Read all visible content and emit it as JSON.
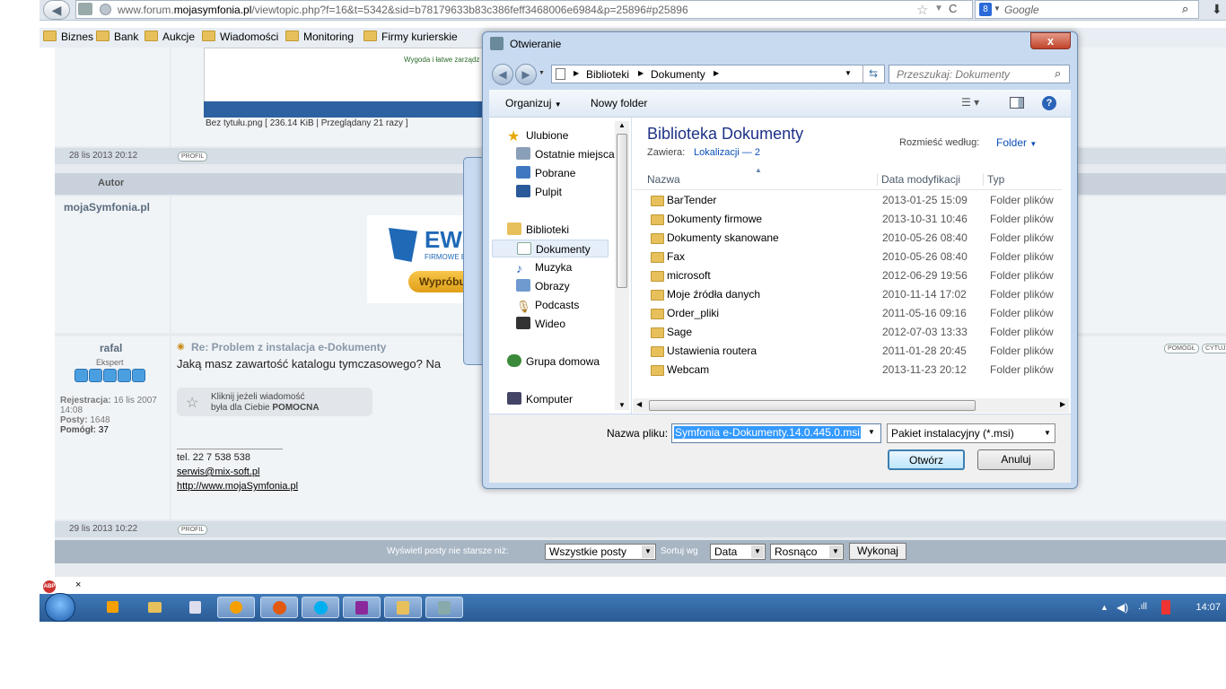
{
  "browser": {
    "url_prefix": "www.forum.",
    "url_domain": "mojasymfonia.pl",
    "url_suffix": "/viewtopic.php?f=16&t=5342&sid=b78179633b83c386feff3468006e6984&p=25896#p25896",
    "search_placeholder": "Google",
    "bookmarks": [
      "Biznes",
      "Bank",
      "Aukcje",
      "Wiadomości",
      "Monitoring",
      "Firmy kurierskie"
    ]
  },
  "forum": {
    "attachment_caption": "Bez tytułu.png [ 236.14 KiB | Przeglądany 21 razy ]",
    "banner_text": "Wygoda i łatwe zarządz",
    "post1_date": "28 lis 2013 20:12",
    "profil_label": "PROFIL",
    "author_header": "Autor",
    "ad_author": "mojaSymfonia.pl",
    "ad_logo": "EWI",
    "ad_sub": "FIRMOWE E",
    "ad_button": "Wypróbu",
    "user_name": "rafal",
    "user_rank": "Ekspert",
    "reg_label": "Rejestracja:",
    "reg_value": "16 lis 2007 14:08",
    "posts_label": "Posty:",
    "posts_value": "1648",
    "helped_label": "Pomógł:",
    "helped_value": "37",
    "post_title": "Re: Problem z instalacja e-Dokumenty",
    "post_text": "Jaką masz zawartość katalogu tymczasowego? Na",
    "helpful_line1": "Kliknij jeżeli wiadomość",
    "helpful_line2": "była dla Ciebie",
    "helpful_bold": "POMOCNA",
    "sig_phone": "tel. 22 7 538 538",
    "sig_email": "serwis@mix-soft.pl",
    "sig_url": "http://www.mojaSymfonia.pl",
    "post2_date": "29 lis 2013 10:22",
    "pomoge_label": "POMÓGŁ",
    "cytuj_label": "CYTUJ",
    "filter_label": "Wyświetl posty nie starsze niż:",
    "filter_value": "Wszystkie posty",
    "sort_label": "Sortuj wg",
    "sort_value": "Data",
    "order_value": "Rosnąco",
    "go_button": "Wykonaj"
  },
  "taskbar": {
    "clock": "14:07"
  },
  "dialog": {
    "title": "Otwieranie",
    "close": "x",
    "path": [
      "Biblioteki",
      "Dokumenty"
    ],
    "search_placeholder": "Przeszukaj: Dokumenty",
    "organize": "Organizuj",
    "new_folder": "Nowy folder",
    "library_title": "Biblioteka Dokumenty",
    "contains_label": "Zawiera:",
    "contains_link": "Lokalizacji — 2",
    "arrange_label": "Rozmieść według:",
    "arrange_value": "Folder",
    "col_name": "Nazwa",
    "col_date": "Data modyfikacji",
    "col_type": "Typ",
    "nav": {
      "favorites": "Ulubione",
      "recent": "Ostatnie miejsca",
      "downloads": "Pobrane",
      "desktop": "Pulpit",
      "libraries": "Biblioteki",
      "documents": "Dokumenty",
      "music": "Muzyka",
      "pictures": "Obrazy",
      "podcasts": "Podcasts",
      "video": "Wideo",
      "homegroup": "Grupa domowa",
      "computer": "Komputer"
    },
    "files": [
      {
        "name": "BarTender",
        "date": "2013-01-25 15:09",
        "type": "Folder plików"
      },
      {
        "name": "Dokumenty firmowe",
        "date": "2013-10-31 10:46",
        "type": "Folder plików"
      },
      {
        "name": "Dokumenty skanowane",
        "date": "2010-05-26 08:40",
        "type": "Folder plików"
      },
      {
        "name": "Fax",
        "date": "2010-05-26 08:40",
        "type": "Folder plików"
      },
      {
        "name": "microsoft",
        "date": "2012-06-29 19:56",
        "type": "Folder plików"
      },
      {
        "name": "Moje źródła danych",
        "date": "2010-11-14 17:02",
        "type": "Folder plików"
      },
      {
        "name": "Order_pliki",
        "date": "2011-05-16 09:16",
        "type": "Folder plików"
      },
      {
        "name": "Sage",
        "date": "2012-07-03 13:33",
        "type": "Folder plików"
      },
      {
        "name": "Ustawienia routera",
        "date": "2011-01-28 20:45",
        "type": "Folder plików"
      },
      {
        "name": "Webcam",
        "date": "2013-11-23 20:12",
        "type": "Folder plików"
      }
    ],
    "filename_label": "Nazwa pliku:",
    "filename_value": "Symfonia e-Dokumenty.14.0.445.0.msi",
    "filetype_value": "Pakiet instalacyjny (*.msi)",
    "open_button": "Otwórz",
    "cancel_button": "Anuluj"
  },
  "colors": {
    "dialog_heading": "#1e3287",
    "link": "#0b4fb8",
    "selection": "#3399ff",
    "taskbar": "#2f65a3"
  }
}
